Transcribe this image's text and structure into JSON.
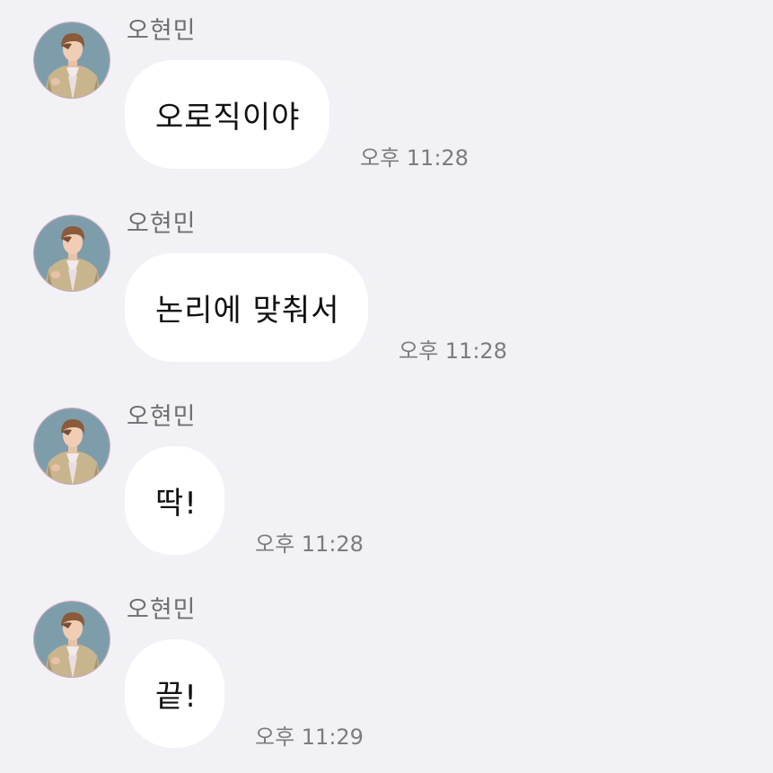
{
  "chat": {
    "messages": [
      {
        "sender": "오현민",
        "text": "오로직이야",
        "time": "오후 11:28"
      },
      {
        "sender": "오현민",
        "text": "논리에 맞춰서",
        "time": "오후 11:28"
      },
      {
        "sender": "오현민",
        "text": "딱!",
        "time": "오후 11:28"
      },
      {
        "sender": "오현민",
        "text": "끝!",
        "time": "오후 11:29"
      }
    ]
  },
  "colors": {
    "background": "#f2f1f6",
    "bubble": "#ffffff",
    "sender_text": "#6f6f6f",
    "time_text": "#7c7c7c",
    "avatar_bg": "#7e9dab"
  }
}
